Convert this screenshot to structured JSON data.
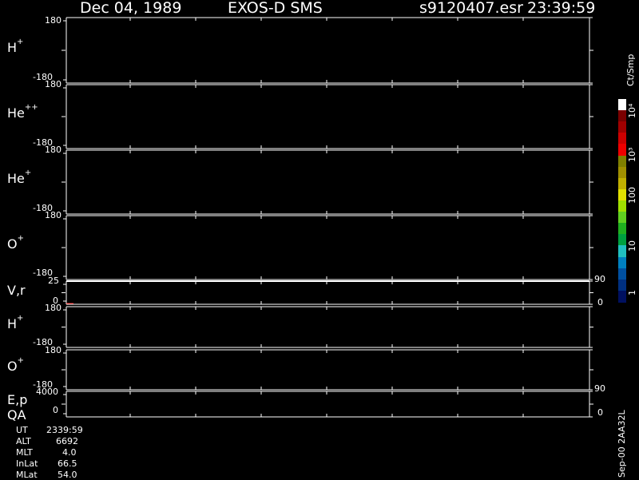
{
  "header": {
    "date": "Dec 04, 1989",
    "instrument": "EXOS-D SMS",
    "file": "s9120407.esr",
    "time": "23:39:59"
  },
  "panels": [
    {
      "id": "h-plus-1",
      "species": "H",
      "charge": "+",
      "tick_top": "180",
      "tick_bottom": "-180"
    },
    {
      "id": "he-plusplus",
      "species": "He",
      "charge": "++",
      "tick_top": "180",
      "tick_bottom": "-180"
    },
    {
      "id": "he-plus",
      "species": "He",
      "charge": "+",
      "tick_top": "180",
      "tick_bottom": "-180"
    },
    {
      "id": "o-plus-1",
      "species": "O",
      "charge": "+",
      "tick_top": "180",
      "tick_bottom": "-180"
    },
    {
      "id": "v-r",
      "species": "V,r",
      "charge": "",
      "tick_top": "25",
      "tick_bottom": "0",
      "right_top": "90",
      "right_bottom": "0"
    },
    {
      "id": "h-plus-2",
      "species": "H",
      "charge": "+",
      "tick_top": "180",
      "tick_bottom": "-180"
    },
    {
      "id": "o-plus-2",
      "species": "O",
      "charge": "+",
      "tick_top": "180",
      "tick_bottom": "-180"
    },
    {
      "id": "e-p",
      "species": "E,p",
      "charge": "",
      "tick_top": "4000",
      "tick_bottom": "0",
      "right_top": "90",
      "right_bottom": "0"
    }
  ],
  "qa_label": "QA",
  "colorbar": {
    "unit": "Ct/Smp",
    "labels": [
      "10⁴",
      "10³",
      "100",
      "10",
      "1"
    ],
    "colors": [
      "#ffffff",
      "#7a0000",
      "#a00000",
      "#cc0000",
      "#ee0000",
      "#808000",
      "#a09000",
      "#c0b000",
      "#e0e000",
      "#a0e000",
      "#60d020",
      "#20b020",
      "#00a040",
      "#20c0c0",
      "#0080c0",
      "#0050a0",
      "#003080",
      "#001060"
    ]
  },
  "ephemeris": [
    {
      "label": "UT",
      "value": "2339:59"
    },
    {
      "label": "ALT",
      "value": "6692"
    },
    {
      "label": "MLT",
      "value": "4.0"
    },
    {
      "label": "InLat",
      "value": "66.5"
    },
    {
      "label": "MLat",
      "value": "54.0"
    }
  ],
  "footer_id": "Sep-00 2AA32L",
  "chart_data": {
    "type": "heatmap",
    "title": "Dec 04, 1989   EXOS-D SMS   s9120407.esr  23:39:59",
    "series": [
      {
        "name": "H+",
        "ylim": [
          -180,
          180
        ],
        "values": []
      },
      {
        "name": "He++",
        "ylim": [
          -180,
          180
        ],
        "values": []
      },
      {
        "name": "He+",
        "ylim": [
          -180,
          180
        ],
        "values": []
      },
      {
        "name": "O+",
        "ylim": [
          -180,
          180
        ],
        "values": []
      },
      {
        "name": "V,r",
        "ylim": [
          0,
          25
        ],
        "right_ylim": [
          0,
          90
        ],
        "values": []
      },
      {
        "name": "H+",
        "ylim": [
          -180,
          180
        ],
        "values": []
      },
      {
        "name": "O+",
        "ylim": [
          -180,
          180
        ],
        "values": []
      },
      {
        "name": "E,p",
        "ylim": [
          0,
          4000
        ],
        "right_ylim": [
          0,
          90
        ],
        "values": []
      }
    ],
    "colorbar_unit": "Ct/Smp"
  }
}
